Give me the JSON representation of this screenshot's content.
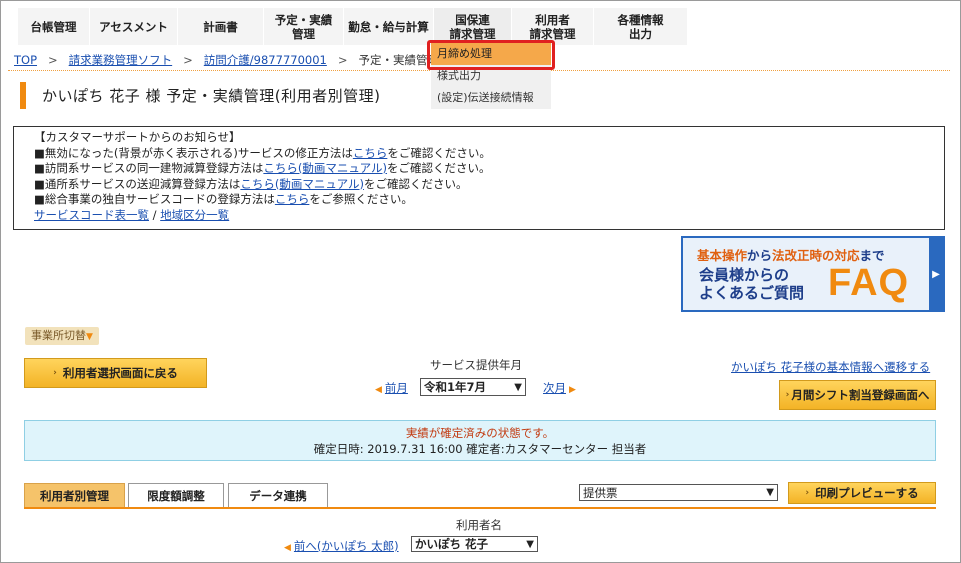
{
  "nav": {
    "items": [
      {
        "label": "台帳管理"
      },
      {
        "label": "アセスメント"
      },
      {
        "label": "計画書"
      },
      {
        "label": "予定・実績\n管理"
      },
      {
        "label": "勤怠・給与計算"
      },
      {
        "label": "国保連\n請求管理"
      },
      {
        "label": "利用者\n請求管理"
      },
      {
        "label": "各種情報\n出力"
      }
    ]
  },
  "dropdown": {
    "items": [
      {
        "label": "月締め処理"
      },
      {
        "label": "様式出力"
      },
      {
        "label": "(設定)伝送接続情報"
      }
    ]
  },
  "breadcrumb": {
    "top": "TOP",
    "software": "請求業務管理ソフト",
    "service": "訪問介護/9877770001",
    "current": "予定・実績管理"
  },
  "title": "かいぽち 花子 様 予定・実績管理(利用者別管理)",
  "notice": {
    "heading": "【カスタマーサポートからのお知らせ】",
    "line1_pre": "■無効になった(背景が赤く表示される)サービスの修正方法は",
    "line1_link": "こちら",
    "line1_post": "をご確認ください。",
    "line2_pre": "■訪問系サービスの同一建物減算登録方法は",
    "line2_link": "こちら(動画マニュアル)",
    "line2_post": "をご確認ください。",
    "line3_pre": "■通所系サービスの送迎減算登録方法は",
    "line3_link": "こちら(動画マニュアル)",
    "line3_post": "をご確認ください。",
    "line4_pre": "■総合事業の独自サービスコードの登録方法は",
    "line4_link": "こちら",
    "line4_post": "をご参照ください。",
    "link_service_codes": "サービスコード表一覧",
    "slash": "/",
    "link_regions": "地域区分一覧"
  },
  "faq": {
    "line1_a": "基本操作",
    "line1_b": "から",
    "line1_c": "法改正時の対応",
    "line1_d": "まで",
    "line2": "会員様からの",
    "line3": "よくあるご質問",
    "big": "FAQ"
  },
  "office_switch": "事業所切替",
  "back_button": "利用者選択画面に戻る",
  "period": {
    "label": "サービス提供年月",
    "prev": "前月",
    "selected": "令和1年7月",
    "next": "次月"
  },
  "basic_info_link": "かいぽち 花子様の基本情報へ遷移する",
  "shift_button": "月間シフト割当登録画面へ",
  "status": {
    "line1": "実績が確定済みの状態です。",
    "line2": "確定日時: 2019.7.31 16:00 確定者:カスタマーセンター 担当者"
  },
  "tabs": [
    {
      "label": "利用者別管理"
    },
    {
      "label": "限度額調整"
    },
    {
      "label": "データ連携"
    }
  ],
  "print_select": "提供票",
  "print_button": "印刷プレビューする",
  "user": {
    "label": "利用者名",
    "prev": "前へ(かいぽち 太郎)",
    "selected": "かいぽち 花子"
  },
  "colors": {
    "accent_orange": "#f08a10",
    "link_blue": "#1a4fb0",
    "highlight_red": "#e02020"
  }
}
